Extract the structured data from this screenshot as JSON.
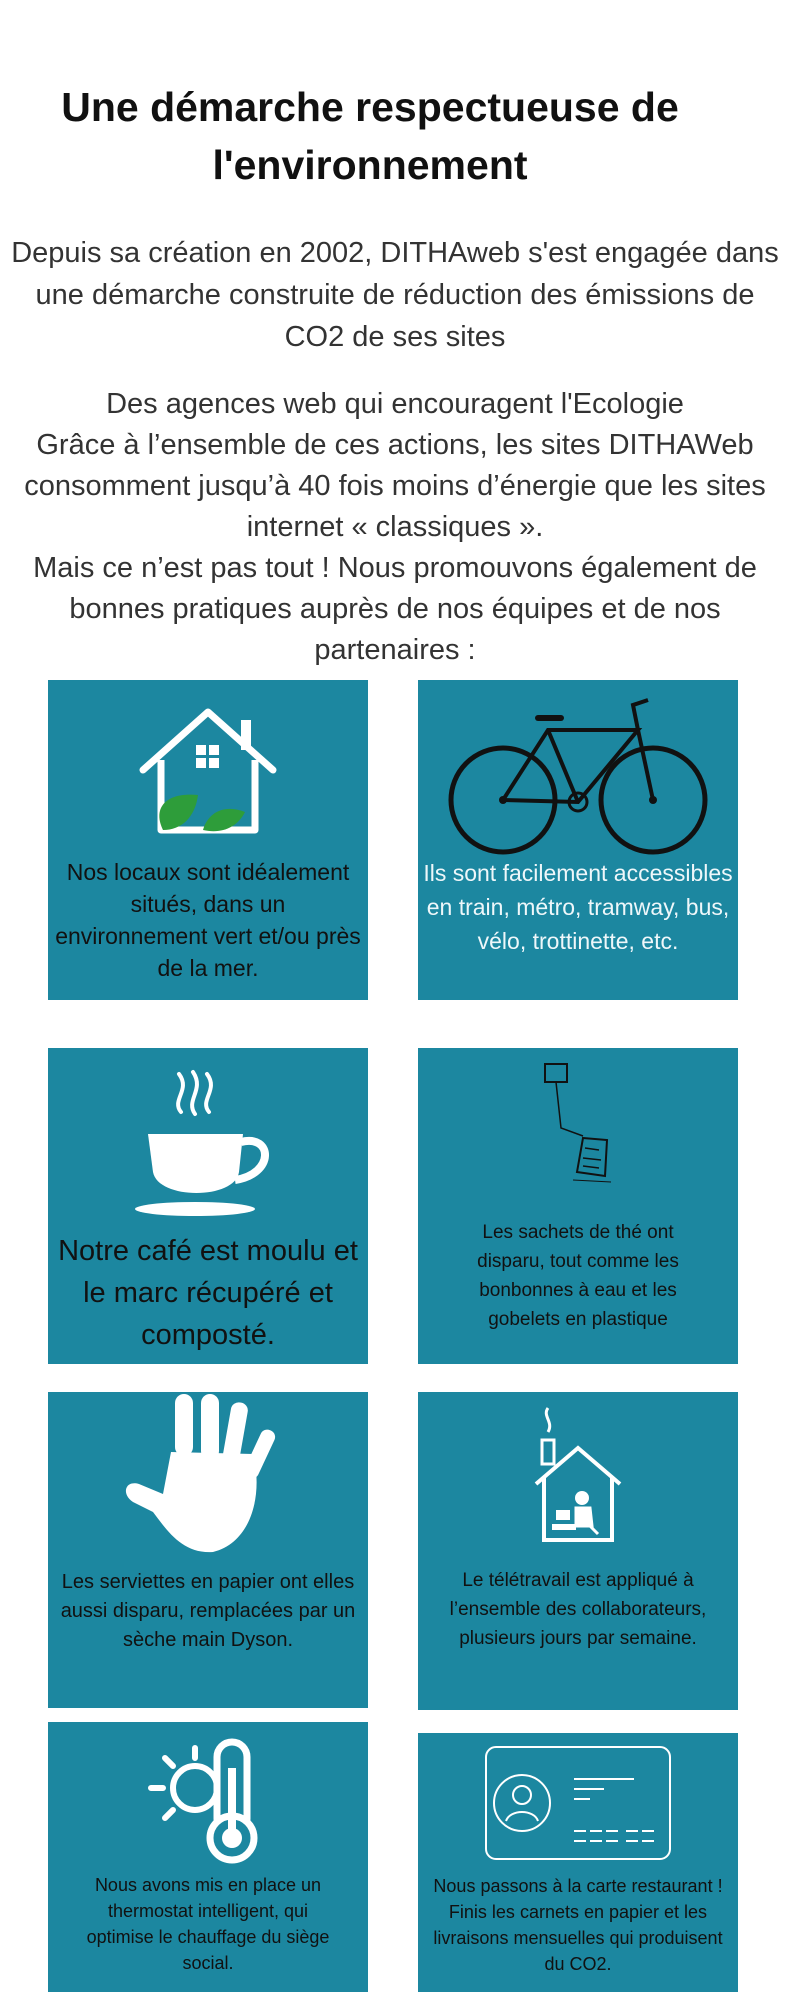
{
  "title": "Une démarche respectueuse de l'environnement",
  "intro": "Depuis sa création en 2002, DITHAweb s'est engagée dans une démarche construite de réduction des émissions de CO2 de ses sites",
  "paragraph": {
    "heading": "Des agences web qui encouragent l'Ecologie",
    "line2": "Grâce à l’ensemble de ces actions, les sites DITHAWeb consomment jusqu’à 40 fois moins d’énergie que les sites internet « classiques ».",
    "line3": "Mais ce n’est pas tout ! Nous promouvons également de bonnes pratiques auprès de nos équipes et de nos partenaires :"
  },
  "cards": [
    {
      "icon": "house-leaf-icon",
      "text": "Nos locaux sont idéalement situés, dans un environnement vert et/ou près de la mer."
    },
    {
      "icon": "bicycle-icon",
      "text": "Ils sont facilement accessibles en train, métro, tramway, bus, vélo, trottinette, etc."
    },
    {
      "icon": "coffee-cup-icon",
      "text": "Notre café est moulu et le marc récupéré et composté."
    },
    {
      "icon": "tea-bag-icon",
      "text": "Les sachets de thé ont disparu, tout comme les bonbonnes à eau et les gobelets en plastique"
    },
    {
      "icon": "hand-icon",
      "text": "Les serviettes en papier ont elles aussi disparu, remplacées par un sèche main Dyson."
    },
    {
      "icon": "home-office-icon",
      "text": "Le télétravail est appliqué à l’ensemble des collaborateurs, plusieurs jours par semaine."
    },
    {
      "icon": "thermostat-icon",
      "text": "Nous avons mis en place un thermostat intelligent, qui optimise le chauffage du siège social."
    },
    {
      "icon": "restaurant-card-icon",
      "text": "Nous passons à la carte restaurant ! Finis les carnets en papier et les livraisons mensuelles qui produisent du CO2."
    }
  ],
  "colors": {
    "card_background": "#1c87a0",
    "icon_white": "#ffffff",
    "leaf_green": "#2e9d3a",
    "text_dark": "#111111"
  }
}
